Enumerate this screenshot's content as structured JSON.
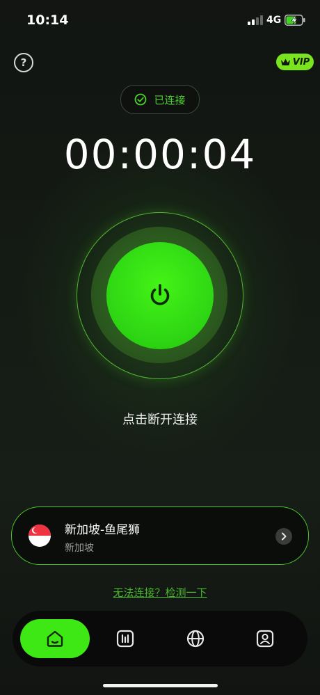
{
  "status_bar": {
    "time": "10:14",
    "network": "4G"
  },
  "header": {
    "help_icon": "question-icon",
    "vip_label": "VIP",
    "vip_icon": "crown-icon"
  },
  "connection": {
    "status_label": "已连接",
    "status_icon": "check-circle-icon",
    "elapsed": "00:00:04",
    "power_icon": "power-icon",
    "hint": "点击断开连接"
  },
  "server": {
    "name": "新加坡-鱼尾狮",
    "country": "新加坡",
    "flag_icon": "singapore-flag-icon",
    "arrow_icon": "chevron-right-icon"
  },
  "diagnostic_link": "无法连接？检测一下",
  "tabs": [
    {
      "icon": "home-icon",
      "active": true
    },
    {
      "icon": "stats-icon",
      "active": false
    },
    {
      "icon": "globe-icon",
      "active": false
    },
    {
      "icon": "profile-icon",
      "active": false
    }
  ],
  "colors": {
    "accent_green": "#3ee815",
    "status_green": "#4cd22d",
    "vip_green": "#7ae51e",
    "link_green": "#49b82c"
  }
}
